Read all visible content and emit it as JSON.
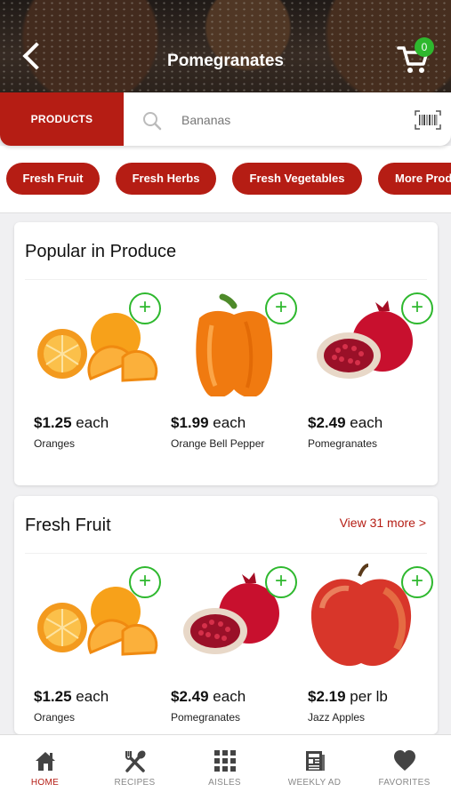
{
  "header": {
    "title": "Pomegranates",
    "cart_count": "0"
  },
  "search": {
    "products_label": "PRODUCTS",
    "placeholder": "Bananas"
  },
  "chips": [
    "Fresh Fruit",
    "Fresh Herbs",
    "Fresh Vegetables",
    "More Prod"
  ],
  "sections": [
    {
      "title": "Popular in Produce",
      "view_more": "",
      "products": [
        {
          "price": "$1.25",
          "unit": "each",
          "name": "Oranges"
        },
        {
          "price": "$1.99",
          "unit": "each",
          "name": "Orange Bell Pepper"
        },
        {
          "price": "$2.49",
          "unit": "each",
          "name": "Pomegranates"
        }
      ]
    },
    {
      "title": "Fresh Fruit",
      "view_more": "View 31 more >",
      "products": [
        {
          "price": "$1.25",
          "unit": "each",
          "name": "Oranges"
        },
        {
          "price": "$2.49",
          "unit": "each",
          "name": "Pomegranates"
        },
        {
          "price": "$2.19",
          "unit": "per lb",
          "name": "Jazz Apples"
        }
      ]
    }
  ],
  "nav": [
    {
      "label": "HOME",
      "icon": "home-icon",
      "active": true
    },
    {
      "label": "RECIPES",
      "icon": "utensils-icon",
      "active": false
    },
    {
      "label": "AISLES",
      "icon": "grid-icon",
      "active": false
    },
    {
      "label": "WEEKLY AD",
      "icon": "newspaper-icon",
      "active": false
    },
    {
      "label": "FAVORITES",
      "icon": "heart-icon",
      "active": false
    }
  ],
  "colors": {
    "brand_red": "#b51d14",
    "add_green": "#2eb82e"
  },
  "icons": [
    "back-arrow-icon",
    "cart-icon",
    "search-icon",
    "barcode-icon",
    "plus-icon"
  ]
}
